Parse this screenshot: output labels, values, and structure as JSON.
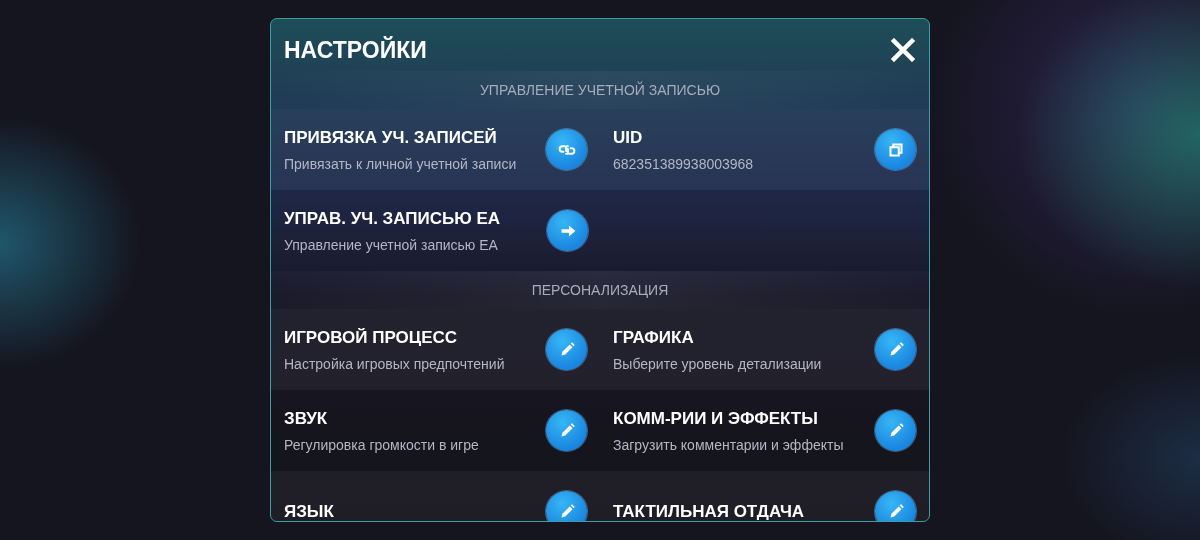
{
  "window": {
    "title": "НАСТРОЙКИ"
  },
  "sections": [
    {
      "heading": "УПРАВЛЕНИЕ УЧЕТНОЙ ЗАПИСЬЮ",
      "items": [
        {
          "title": "ПРИВЯЗКА УЧ. ЗАПИСЕЙ",
          "subtitle": "Привязать к личной учетной записи",
          "kind": "link"
        },
        {
          "title": "UID",
          "subtitle": "682351389938003968",
          "kind": "copy"
        },
        {
          "title": "УПРАВ. УЧ. ЗАПИСЬЮ EA",
          "subtitle": "Управление учетной записью EA",
          "kind": "arrow"
        }
      ]
    },
    {
      "heading": "ПЕРСОНАЛИЗАЦИЯ",
      "items": [
        {
          "title": "ИГРОВОЙ ПРОЦЕСС",
          "subtitle": "Настройка игровых предпочтений",
          "kind": "edit"
        },
        {
          "title": "ГРАФИКА",
          "subtitle": "Выберите уровень детализации",
          "kind": "edit"
        },
        {
          "title": "ЗВУК",
          "subtitle": "Регулировка громкости в игре",
          "kind": "edit"
        },
        {
          "title": "КОММ-РИИ И ЭФФЕКТЫ",
          "subtitle": "Загрузить комментарии и эффекты",
          "kind": "edit"
        },
        {
          "title": "ЯЗЫК",
          "kind": "edit"
        },
        {
          "title": "ТАКТИЛЬНАЯ ОТДАЧА",
          "kind": "edit"
        }
      ]
    }
  ]
}
